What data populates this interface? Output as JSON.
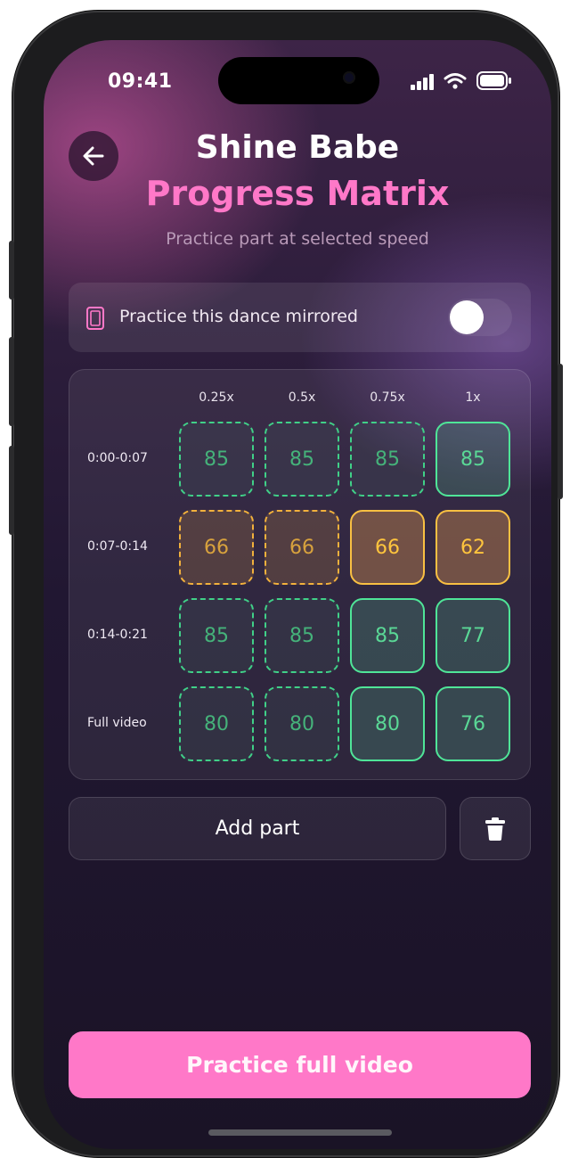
{
  "status_bar": {
    "time": "09:41"
  },
  "header": {
    "title": "Shine Babe",
    "subtitle_title": "Progress Matrix",
    "description": "Practice part at selected speed"
  },
  "mirror": {
    "label": "Practice this dance mirrored",
    "enabled": false
  },
  "matrix": {
    "speeds": [
      "0.25x",
      "0.5x",
      "0.75x",
      "1x"
    ],
    "rows": [
      {
        "part": "0:00-0:07",
        "scores": [
          "85",
          "85",
          "85",
          "85"
        ]
      },
      {
        "part": "0:07-0:14",
        "scores": [
          "66",
          "66",
          "66",
          "62"
        ]
      },
      {
        "part": "0:14-0:21",
        "scores": [
          "85",
          "85",
          "85",
          "77"
        ]
      },
      {
        "part": "Full video",
        "scores": [
          "80",
          "80",
          "80",
          "76"
        ]
      }
    ]
  },
  "actions": {
    "add_part_label": "Add part",
    "practice_full_label": "Practice full video"
  },
  "colors": {
    "accent_pink": "#ff78c8",
    "score_green": "#4fe598",
    "score_amber": "#f9c042"
  },
  "icons": [
    "back-arrow-icon",
    "signal-icon",
    "wifi-icon",
    "battery-icon",
    "mirror-icon",
    "trash-icon"
  ]
}
